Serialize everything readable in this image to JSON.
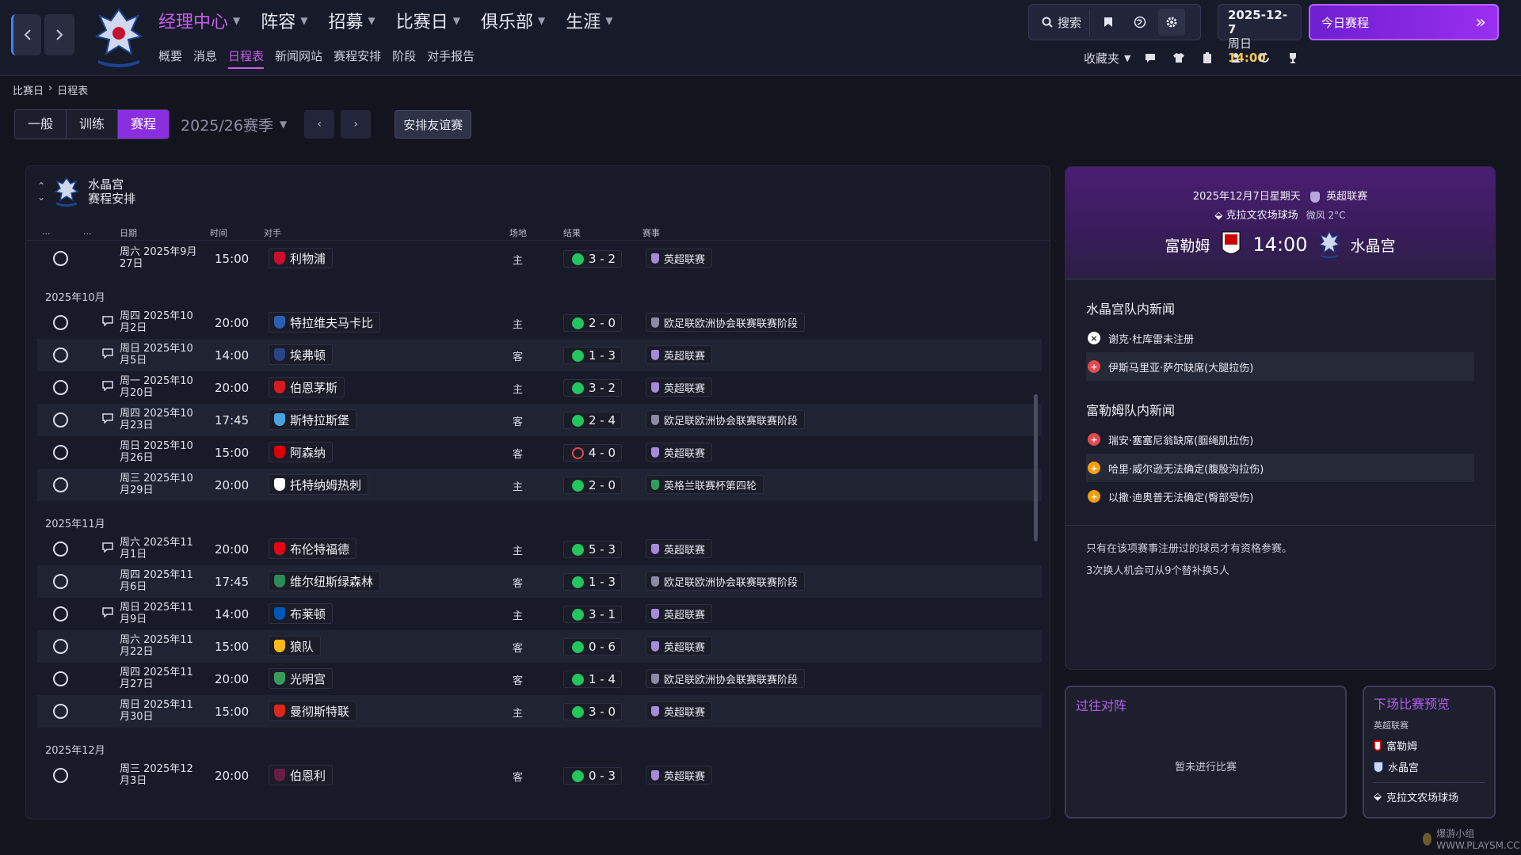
{
  "nav": {
    "back_icon": "chevron-left-icon",
    "forward_icon": "chevron-right-icon",
    "menu": [
      {
        "label": "经理中心"
      },
      {
        "label": "阵容"
      },
      {
        "label": "招募"
      },
      {
        "label": "比赛日"
      },
      {
        "label": "俱乐部"
      },
      {
        "label": "生涯"
      }
    ],
    "submenu": [
      {
        "label": "概要"
      },
      {
        "label": "消息"
      },
      {
        "label": "日程表"
      },
      {
        "label": "新闻网站"
      },
      {
        "label": "赛程安排"
      },
      {
        "label": "阶段"
      },
      {
        "label": "对手报告"
      }
    ],
    "active_menu": "经理中心",
    "active_submenu": "日程表"
  },
  "toolbar_top": {
    "search_label": "搜索",
    "date_line1": "2025-12-7",
    "date_weekday": "周日",
    "date_time": "14:00",
    "today_button": "今日赛程",
    "favorites_label": "收藏夹"
  },
  "breadcrumb": {
    "root": "比赛日",
    "current": "日程表"
  },
  "filters": {
    "segments": [
      "一般",
      "训练",
      "赛程"
    ],
    "active_segment": "赛程",
    "season": "2025/26赛季",
    "friendly_button": "安排友谊赛"
  },
  "schedule": {
    "club": "水晶宫",
    "subtitle": "赛程安排",
    "columns": {
      "c1": "...",
      "c2": "...",
      "date": "日期",
      "time": "时间",
      "opponent": "对手",
      "venue": "场地",
      "result": "结果",
      "competition": "赛事"
    },
    "first_row": {
      "date": "周六 2025年9月27日",
      "time": "15:00",
      "opponent": "利物浦",
      "venue": "主",
      "result": "3 - 2",
      "outcome": "win",
      "competition": "英超联赛",
      "chat": false,
      "opp_color": "#c8102e"
    },
    "months": [
      {
        "label": "2025年10月",
        "matches": [
          {
            "date": "周四 2025年10月2日",
            "time": "20:00",
            "opponent": "特拉维夫马卡比",
            "venue": "主",
            "result": "2 - 0",
            "outcome": "win",
            "competition": "欧足联欧洲协会联赛联赛阶段",
            "chat": true,
            "opp_color": "#2c5fb3"
          },
          {
            "date": "周日 2025年10月5日",
            "time": "14:00",
            "opponent": "埃弗顿",
            "venue": "客",
            "result": "1 - 3",
            "outcome": "win",
            "competition": "英超联赛",
            "chat": true,
            "opp_color": "#274488"
          },
          {
            "date": "周一 2025年10月20日",
            "time": "20:00",
            "opponent": "伯恩茅斯",
            "venue": "主",
            "result": "3 - 2",
            "outcome": "win",
            "competition": "英超联赛",
            "chat": true,
            "opp_color": "#d71920"
          },
          {
            "date": "周四 2025年10月23日",
            "time": "17:45",
            "opponent": "斯特拉斯堡",
            "venue": "客",
            "result": "2 - 4",
            "outcome": "win",
            "competition": "欧足联欧洲协会联赛联赛阶段",
            "chat": true,
            "opp_color": "#4aa3df"
          },
          {
            "date": "周日 2025年10月26日",
            "time": "15:00",
            "opponent": "阿森纳",
            "venue": "客",
            "result": "4 - 0",
            "outcome": "loss",
            "competition": "英超联赛",
            "chat": false,
            "opp_color": "#db0007"
          },
          {
            "date": "周三 2025年10月29日",
            "time": "20:00",
            "opponent": "托特纳姆热刺",
            "venue": "主",
            "result": "2 - 0",
            "outcome": "win",
            "competition": "英格兰联赛杯第四轮",
            "chat": false,
            "opp_color": "#ffffff"
          }
        ]
      },
      {
        "label": "2025年11月",
        "matches": [
          {
            "date": "周六 2025年11月1日",
            "time": "20:00",
            "opponent": "布伦特福德",
            "venue": "主",
            "result": "5 - 3",
            "outcome": "win",
            "competition": "英超联赛",
            "chat": true,
            "opp_color": "#e30613"
          },
          {
            "date": "周四 2025年11月6日",
            "time": "17:45",
            "opponent": "维尔纽斯绿森林",
            "venue": "客",
            "result": "1 - 3",
            "outcome": "win",
            "competition": "欧足联欧洲协会联赛联赛阶段",
            "chat": false,
            "opp_color": "#2e8b57"
          },
          {
            "date": "周日 2025年11月9日",
            "time": "14:00",
            "opponent": "布莱顿",
            "venue": "主",
            "result": "3 - 1",
            "outcome": "win",
            "competition": "英超联赛",
            "chat": true,
            "opp_color": "#0057b8"
          },
          {
            "date": "周六 2025年11月22日",
            "time": "15:00",
            "opponent": "狼队",
            "venue": "客",
            "result": "0 - 6",
            "outcome": "win",
            "competition": "英超联赛",
            "chat": false,
            "opp_color": "#fdb913"
          },
          {
            "date": "周四 2025年11月27日",
            "time": "20:00",
            "opponent": "光明宫",
            "venue": "客",
            "result": "1 - 4",
            "outcome": "win",
            "competition": "欧足联欧洲协会联赛联赛阶段",
            "chat": false,
            "opp_color": "#3a9a5b"
          },
          {
            "date": "周日 2025年11月30日",
            "time": "15:00",
            "opponent": "曼彻斯特联",
            "venue": "主",
            "result": "3 - 0",
            "outcome": "win",
            "competition": "英超联赛",
            "chat": false,
            "opp_color": "#da291c"
          }
        ]
      },
      {
        "label": "2025年12月",
        "matches": [
          {
            "date": "周三 2025年12月3日",
            "time": "20:00",
            "opponent": "伯恩利",
            "venue": "客",
            "result": "0 - 3",
            "outcome": "win",
            "competition": "英超联赛",
            "chat": false,
            "opp_color": "#6c1d45"
          }
        ]
      }
    ]
  },
  "match_info": {
    "date_line": "2025年12月7日星期天",
    "competition": "英超联赛",
    "stadium": "克拉文农场球场",
    "weather": "微风 2°C",
    "home": "富勒姆",
    "kickoff": "14:00",
    "away": "水晶宫",
    "home_news_title": "水晶宫队内新闻",
    "home_news": [
      {
        "text": "谢克·杜库雷未注册",
        "type": "x"
      },
      {
        "text": "伊斯马里亚·萨尔缺席(大腿拉伤)",
        "type": "red"
      }
    ],
    "away_news_title": "富勒姆队内新闻",
    "away_news": [
      {
        "text": "瑞安·塞塞尼翁缺席(腘绳肌拉伤)",
        "type": "red"
      },
      {
        "text": "哈里·威尔逊无法确定(腹股沟拉伤)",
        "type": "amber"
      },
      {
        "text": "以撒·迪奥普无法确定(臀部受伤)",
        "type": "amber"
      }
    ],
    "rule1": "只有在该项赛事注册过的球员才有资格参赛。",
    "rule2": "3次换人机会可从9个替补换5人"
  },
  "h2h": {
    "title": "过往对阵",
    "empty": "暂未进行比赛"
  },
  "next_match": {
    "title": "下场比赛预览",
    "competition": "英超联赛",
    "home": "富勒姆",
    "away": "水晶宫",
    "venue": "克拉文农场球场"
  },
  "watermark": "爆游小组 WWW.PLAYSM.CC",
  "colors": {
    "accent": "#c95cf0",
    "win": "#22c55e",
    "loss": "#e24b4b"
  }
}
